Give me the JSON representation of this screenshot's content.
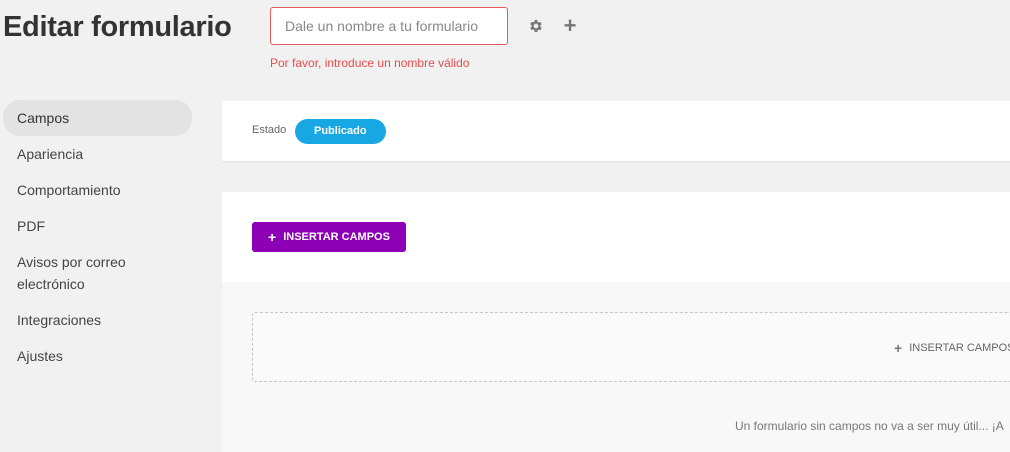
{
  "header": {
    "title": "Editar formulario",
    "name_placeholder": "Dale un nombre a tu formulario",
    "name_value": "",
    "error": "Por favor, introduce un nombre válido",
    "settings_icon": "gear-icon",
    "add_icon": "plus-icon"
  },
  "sidebar": {
    "items": [
      {
        "label": "Campos",
        "active": true
      },
      {
        "label": "Apariencia"
      },
      {
        "label": "Comportamiento"
      },
      {
        "label": "PDF"
      },
      {
        "label": "Avisos por correo electrónico"
      },
      {
        "label": "Integraciones"
      },
      {
        "label": "Ajustes"
      }
    ]
  },
  "status": {
    "label": "Estado",
    "value": "Publicado",
    "color": "#17a8e3"
  },
  "fields": {
    "insert_label": "INSERTAR CAMPOS",
    "insert_color": "#8d00b5",
    "dropzone_label": "INSERTAR CAMPOS",
    "empty_note": "Un formulario sin campos no va a ser muy útil... ¡A"
  }
}
